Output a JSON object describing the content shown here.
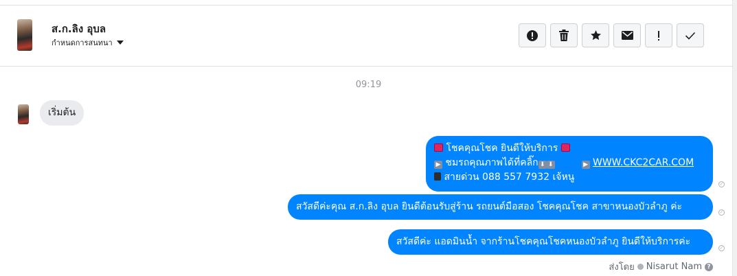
{
  "header": {
    "contact_name": "ส.ก.ลิง อุบล",
    "assign_label": "กำหนดการสนทนา",
    "actions": [
      {
        "icon": "exclamation-circle-icon",
        "label": "report"
      },
      {
        "icon": "trash-icon",
        "label": "delete"
      },
      {
        "icon": "star-icon",
        "label": "star"
      },
      {
        "icon": "envelope-icon",
        "label": "mark unread"
      },
      {
        "icon": "exclamation-icon",
        "label": "follow up"
      },
      {
        "icon": "check-icon",
        "label": "done"
      }
    ]
  },
  "conversation": {
    "timestamp": "09:19",
    "incoming": [
      {
        "text": "เริ่มต้น"
      }
    ],
    "outgoing": {
      "msg1": {
        "line1": "โชคคุณโชค ยินดีให้บริการ",
        "line2_text": "ชมรถคุณภาพได้ที่คลิ๊ก",
        "line2_link": "WWW.CKC2CAR.COM",
        "line3": "สายด่วน 088 557 7932 เจ้หนู"
      },
      "msg2": "สวัสดีค่ะคุณ ส.ก.ลิง อุบล ยินดีต้อนรับสู่ร้าน รถยนต์มือสอง โชคคุณโชค สาขาหนองบัวลำภู ค่ะ",
      "msg3": "สวัสดีค่ะ แอดมินน้ำ จากร้านโชคคุณโชคหนองบัวลำภู ยินดีให้บริการค่ะ"
    },
    "sent_by_label": "ส่งโดย",
    "sent_by_name": "Nisarut Nam"
  },
  "colors": {
    "outgoing_bubble": "#0084ff",
    "incoming_bubble": "#e9ebee"
  }
}
